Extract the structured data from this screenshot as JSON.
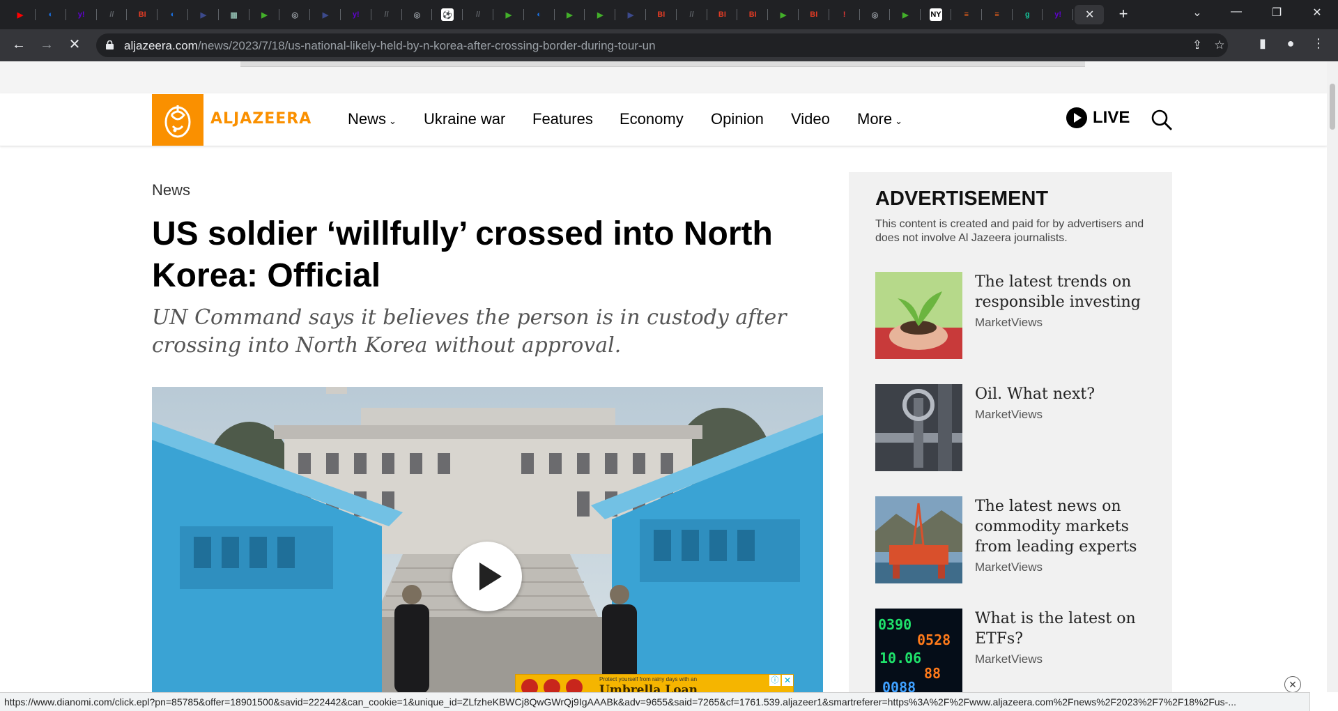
{
  "browser": {
    "tabs": [
      {
        "icon": "youtube-icon",
        "color": "#ff0000",
        "glyph": "▶"
      },
      {
        "icon": "shield-icon",
        "color": "#1a73e8",
        "glyph": "◐"
      },
      {
        "icon": "yahoo-icon",
        "color": "#6001d2",
        "glyph": "y!"
      },
      {
        "icon": "news-icon",
        "color": "#5f6368",
        "glyph": "//"
      },
      {
        "icon": "business-insider-icon",
        "color": "#e03b24",
        "glyph": "BI"
      },
      {
        "icon": "shield-icon",
        "color": "#1a73e8",
        "glyph": "◐"
      },
      {
        "icon": "bookmark-icon",
        "color": "#3c4a8c",
        "glyph": "▶"
      },
      {
        "icon": "map-icon",
        "color": "#8ab4a8",
        "glyph": "▦"
      },
      {
        "icon": "play-icon",
        "color": "#43b02a",
        "glyph": "▶"
      },
      {
        "icon": "globe-icon",
        "color": "#9aa0a6",
        "glyph": "◎"
      },
      {
        "icon": "bookmark-icon",
        "color": "#3c4a8c",
        "glyph": "▶"
      },
      {
        "icon": "yahoo-icon",
        "color": "#6001d2",
        "glyph": "y!"
      },
      {
        "icon": "news-icon",
        "color": "#5f6368",
        "glyph": "//"
      },
      {
        "icon": "globe-icon",
        "color": "#9aa0a6",
        "glyph": "◎"
      },
      {
        "icon": "soccer-icon",
        "color": "#ffffff",
        "glyph": "⚽"
      },
      {
        "icon": "news-icon",
        "color": "#5f6368",
        "glyph": "//"
      },
      {
        "icon": "play-icon",
        "color": "#43b02a",
        "glyph": "▶"
      },
      {
        "icon": "shield-icon",
        "color": "#1a73e8",
        "glyph": "◐"
      },
      {
        "icon": "play-icon",
        "color": "#43b02a",
        "glyph": "▶"
      },
      {
        "icon": "play-icon",
        "color": "#43b02a",
        "glyph": "▶"
      },
      {
        "icon": "bookmark-icon",
        "color": "#3c4a8c",
        "glyph": "▶"
      },
      {
        "icon": "business-insider-icon",
        "color": "#e03b24",
        "glyph": "BI"
      },
      {
        "icon": "news-icon",
        "color": "#5f6368",
        "glyph": "//"
      },
      {
        "icon": "business-insider-icon",
        "color": "#e03b24",
        "glyph": "BI"
      },
      {
        "icon": "business-insider-icon",
        "color": "#e03b24",
        "glyph": "BI"
      },
      {
        "icon": "play-icon",
        "color": "#43b02a",
        "glyph": "▶"
      },
      {
        "icon": "business-insider-icon",
        "color": "#e03b24",
        "glyph": "BI"
      },
      {
        "icon": "alert-icon",
        "color": "#e53935",
        "glyph": "!"
      },
      {
        "icon": "globe-icon",
        "color": "#9aa0a6",
        "glyph": "◎"
      },
      {
        "icon": "play-icon",
        "color": "#43b02a",
        "glyph": "▶"
      },
      {
        "icon": "newspaper-icon",
        "color": "#ffffff",
        "glyph": "NY"
      },
      {
        "icon": "stack-icon",
        "color": "#ff6719",
        "glyph": "≡"
      },
      {
        "icon": "stack-icon",
        "color": "#ff6719",
        "glyph": "≡"
      },
      {
        "icon": "grammarly-icon",
        "color": "#15c39a",
        "glyph": "g"
      },
      {
        "icon": "yahoo-icon",
        "color": "#6001d2",
        "glyph": "y!"
      }
    ],
    "url_host": "aljazeera.com",
    "url_path": "/news/2023/7/18/us-national-likely-held-by-n-korea-after-crossing-border-during-tour-un",
    "status_url": "https://www.dianomi.com/click.epl?pn=85785&offer=18901500&savid=222442&can_cookie=1&unique_id=ZLfzheKBWCj8QwGWrQj9IgAAABk&adv=9655&said=7265&cf=1761.539.aljazeer1&smartreferer=https%3A%2F%2Fwww.aljazeera.com%2Fnews%2F2023%2F7%2F18%2Fus-..."
  },
  "site": {
    "logo_text": "ALJAZEERA",
    "brand_color": "#fa9000",
    "nav": [
      {
        "label": "News",
        "dropdown": true
      },
      {
        "label": "Ukraine war",
        "dropdown": false
      },
      {
        "label": "Features",
        "dropdown": false
      },
      {
        "label": "Economy",
        "dropdown": false
      },
      {
        "label": "Opinion",
        "dropdown": false
      },
      {
        "label": "Video",
        "dropdown": false
      },
      {
        "label": "More",
        "dropdown": true
      }
    ],
    "live_label": "LIVE"
  },
  "article": {
    "kicker": "News",
    "headline": "US soldier ‘willfully’ crossed into North Korea: Official",
    "standfirst": "UN Command says it believes the person is in custody after crossing into North Korea without approval.",
    "ad_banner": {
      "promo": "Protect yourself from rainy days with an",
      "brand": "Umbrella Loan"
    }
  },
  "sidebar": {
    "title": "ADVERTISEMENT",
    "disclaimer": "This content is created and paid for by advertisers and does not involve Al Jazeera journalists.",
    "items": [
      {
        "title": "The latest trends on responsible investing",
        "source": "MarketViews",
        "thumb": "seedling-in-hands"
      },
      {
        "title": "Oil. What next?",
        "source": "MarketViews",
        "thumb": "oil-valve"
      },
      {
        "title": "The latest news on commodity markets from leading experts",
        "source": "MarketViews",
        "thumb": "oil-rig"
      },
      {
        "title": "What is the latest on ETFs?",
        "source": "MarketViews",
        "thumb": "stock-ticker"
      }
    ]
  }
}
